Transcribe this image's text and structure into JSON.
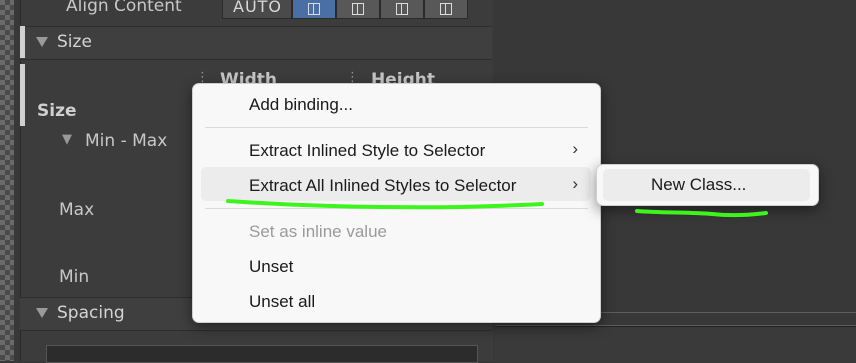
{
  "inspector": {
    "align_content_label": "Align Content",
    "align_content_auto": "AUTO",
    "size_section_title": "Size",
    "size_label": "Size",
    "width_header": "Width",
    "height_header": "Height",
    "min_max_label": "Min - Max",
    "max_label": "Max",
    "min_label": "Min",
    "spacing_section_title": "Spacing"
  },
  "context_menu": {
    "items": [
      {
        "label": "Add binding...",
        "enabled": true,
        "submenu": false
      },
      {
        "label": "Extract Inlined Style to Selector",
        "enabled": true,
        "submenu": true
      },
      {
        "label": "Extract All Inlined Styles to Selector",
        "enabled": true,
        "submenu": true,
        "highlighted": true
      },
      {
        "label": "Set as inline value",
        "enabled": false,
        "submenu": false
      },
      {
        "label": "Unset",
        "enabled": true,
        "submenu": false
      },
      {
        "label": "Unset all",
        "enabled": true,
        "submenu": false
      }
    ],
    "chevron": "›"
  },
  "submenu": {
    "items": [
      {
        "label": "New Class...",
        "highlighted": true
      }
    ]
  },
  "annotation": {
    "color": "#3df51c",
    "kind": "hand-drawn underline"
  }
}
